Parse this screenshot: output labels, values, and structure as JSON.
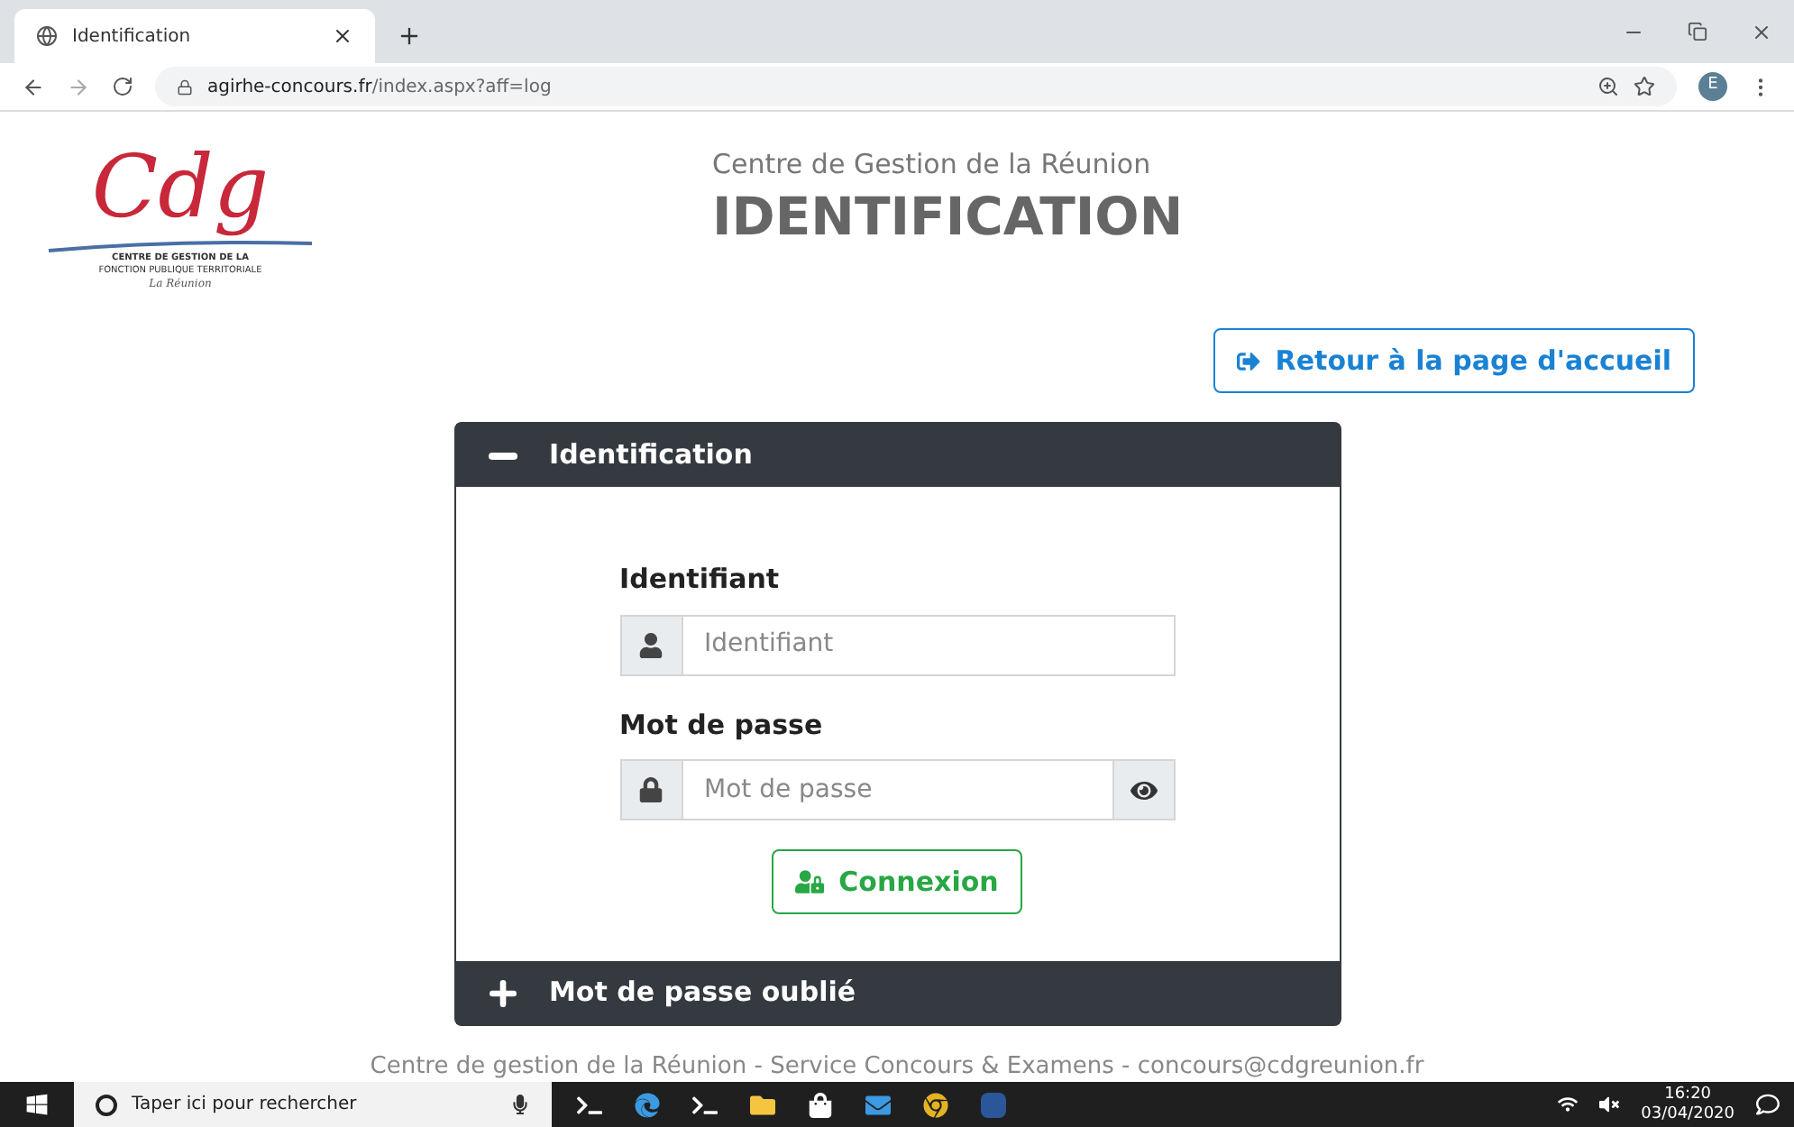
{
  "browser": {
    "tab_title": "Identification",
    "url_host": "agirhe-concours.fr",
    "url_path": "/index.aspx?aff=log",
    "profile_initial": "E"
  },
  "logo": {
    "mark": "Cdg",
    "line_1": "CENTRE DE GESTION DE LA",
    "line_2": "FONCTION PUBLIQUE TERRITORIALE",
    "line_3": "La Réunion"
  },
  "header": {
    "subtitle": "Centre de Gestion de la Réunion",
    "title": "IDENTIFICATION"
  },
  "home_button": "Retour à la page d'accueil",
  "sections": [
    {
      "title": "Identification",
      "expanded": true,
      "fields": [
        {
          "label": "Identifiant",
          "placeholder": "Identifiant",
          "kind": "user"
        },
        {
          "label": "Mot de passe",
          "placeholder": "Mot de passe",
          "kind": "password"
        }
      ],
      "submit": "Connexion"
    },
    {
      "title": "Mot de passe oublié",
      "expanded": false
    }
  ],
  "footer": "Centre de gestion de la Réunion - Service Concours & Examens - concours@cdgreunion.fr",
  "taskbar": {
    "search_placeholder": "Taper ici pour rechercher",
    "time": "16:20",
    "date": "03/04/2020"
  }
}
